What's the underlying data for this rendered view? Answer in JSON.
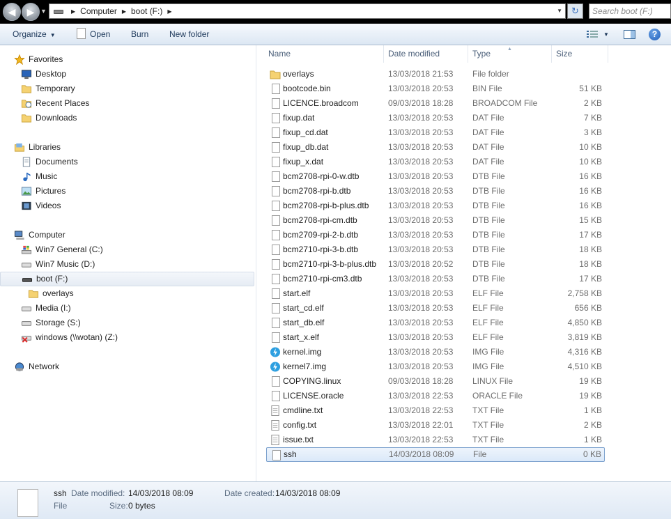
{
  "address": {
    "crumbs": [
      "Computer",
      "boot (F:)"
    ],
    "search_placeholder": "Search boot (F:)"
  },
  "toolbar": {
    "organize": "Organize",
    "open": "Open",
    "burn": "Burn",
    "new_folder": "New folder"
  },
  "nav": {
    "favorites": "Favorites",
    "desktop": "Desktop",
    "temporary": "Temporary",
    "recent_places": "Recent Places",
    "downloads": "Downloads",
    "libraries": "Libraries",
    "documents": "Documents",
    "music": "Music",
    "pictures": "Pictures",
    "videos": "Videos",
    "computer": "Computer",
    "drive_c": "Win7 General (C:)",
    "drive_d": "Win7 Music (D:)",
    "drive_f": "boot (F:)",
    "overlays": "overlays",
    "drive_i": "Media (I:)",
    "drive_s": "Storage (S:)",
    "drive_z": "windows (\\\\wotan) (Z:)",
    "network": "Network"
  },
  "columns": {
    "name": "Name",
    "date": "Date modified",
    "type": "Type",
    "size": "Size"
  },
  "files": [
    {
      "name": "overlays",
      "date": "13/03/2018 21:53",
      "type": "File folder",
      "size": "",
      "icon": "folder"
    },
    {
      "name": "bootcode.bin",
      "date": "13/03/2018 20:53",
      "type": "BIN File",
      "size": "51 KB",
      "icon": "file"
    },
    {
      "name": "LICENCE.broadcom",
      "date": "09/03/2018 18:28",
      "type": "BROADCOM File",
      "size": "2 KB",
      "icon": "file"
    },
    {
      "name": "fixup.dat",
      "date": "13/03/2018 20:53",
      "type": "DAT File",
      "size": "7 KB",
      "icon": "file"
    },
    {
      "name": "fixup_cd.dat",
      "date": "13/03/2018 20:53",
      "type": "DAT File",
      "size": "3 KB",
      "icon": "file"
    },
    {
      "name": "fixup_db.dat",
      "date": "13/03/2018 20:53",
      "type": "DAT File",
      "size": "10 KB",
      "icon": "file"
    },
    {
      "name": "fixup_x.dat",
      "date": "13/03/2018 20:53",
      "type": "DAT File",
      "size": "10 KB",
      "icon": "file"
    },
    {
      "name": "bcm2708-rpi-0-w.dtb",
      "date": "13/03/2018 20:53",
      "type": "DTB File",
      "size": "16 KB",
      "icon": "file"
    },
    {
      "name": "bcm2708-rpi-b.dtb",
      "date": "13/03/2018 20:53",
      "type": "DTB File",
      "size": "16 KB",
      "icon": "file"
    },
    {
      "name": "bcm2708-rpi-b-plus.dtb",
      "date": "13/03/2018 20:53",
      "type": "DTB File",
      "size": "16 KB",
      "icon": "file"
    },
    {
      "name": "bcm2708-rpi-cm.dtb",
      "date": "13/03/2018 20:53",
      "type": "DTB File",
      "size": "15 KB",
      "icon": "file"
    },
    {
      "name": "bcm2709-rpi-2-b.dtb",
      "date": "13/03/2018 20:53",
      "type": "DTB File",
      "size": "17 KB",
      "icon": "file"
    },
    {
      "name": "bcm2710-rpi-3-b.dtb",
      "date": "13/03/2018 20:53",
      "type": "DTB File",
      "size": "18 KB",
      "icon": "file"
    },
    {
      "name": "bcm2710-rpi-3-b-plus.dtb",
      "date": "13/03/2018 20:52",
      "type": "DTB File",
      "size": "18 KB",
      "icon": "file"
    },
    {
      "name": "bcm2710-rpi-cm3.dtb",
      "date": "13/03/2018 20:53",
      "type": "DTB File",
      "size": "17 KB",
      "icon": "file"
    },
    {
      "name": "start.elf",
      "date": "13/03/2018 20:53",
      "type": "ELF File",
      "size": "2,758 KB",
      "icon": "file"
    },
    {
      "name": "start_cd.elf",
      "date": "13/03/2018 20:53",
      "type": "ELF File",
      "size": "656 KB",
      "icon": "file"
    },
    {
      "name": "start_db.elf",
      "date": "13/03/2018 20:53",
      "type": "ELF File",
      "size": "4,850 KB",
      "icon": "file"
    },
    {
      "name": "start_x.elf",
      "date": "13/03/2018 20:53",
      "type": "ELF File",
      "size": "3,819 KB",
      "icon": "file"
    },
    {
      "name": "kernel.img",
      "date": "13/03/2018 20:53",
      "type": "IMG File",
      "size": "4,316 KB",
      "icon": "img"
    },
    {
      "name": "kernel7.img",
      "date": "13/03/2018 20:53",
      "type": "IMG File",
      "size": "4,510 KB",
      "icon": "img"
    },
    {
      "name": "COPYING.linux",
      "date": "09/03/2018 18:28",
      "type": "LINUX File",
      "size": "19 KB",
      "icon": "file"
    },
    {
      "name": "LICENSE.oracle",
      "date": "13/03/2018 22:53",
      "type": "ORACLE File",
      "size": "19 KB",
      "icon": "file"
    },
    {
      "name": "cmdline.txt",
      "date": "13/03/2018 22:53",
      "type": "TXT File",
      "size": "1 KB",
      "icon": "txt"
    },
    {
      "name": "config.txt",
      "date": "13/03/2018 22:01",
      "type": "TXT File",
      "size": "2 KB",
      "icon": "txt"
    },
    {
      "name": "issue.txt",
      "date": "13/03/2018 22:53",
      "type": "TXT File",
      "size": "1 KB",
      "icon": "txt"
    },
    {
      "name": "ssh",
      "date": "14/03/2018 08:09",
      "type": "File",
      "size": "0 KB",
      "icon": "file",
      "selected": true
    }
  ],
  "details": {
    "name": "ssh",
    "type": "File",
    "modified_label": "Date modified:",
    "modified_value": "14/03/2018 08:09",
    "size_label": "Size:",
    "size_value": "0 bytes",
    "created_label": "Date created:",
    "created_value": "14/03/2018 08:09"
  }
}
